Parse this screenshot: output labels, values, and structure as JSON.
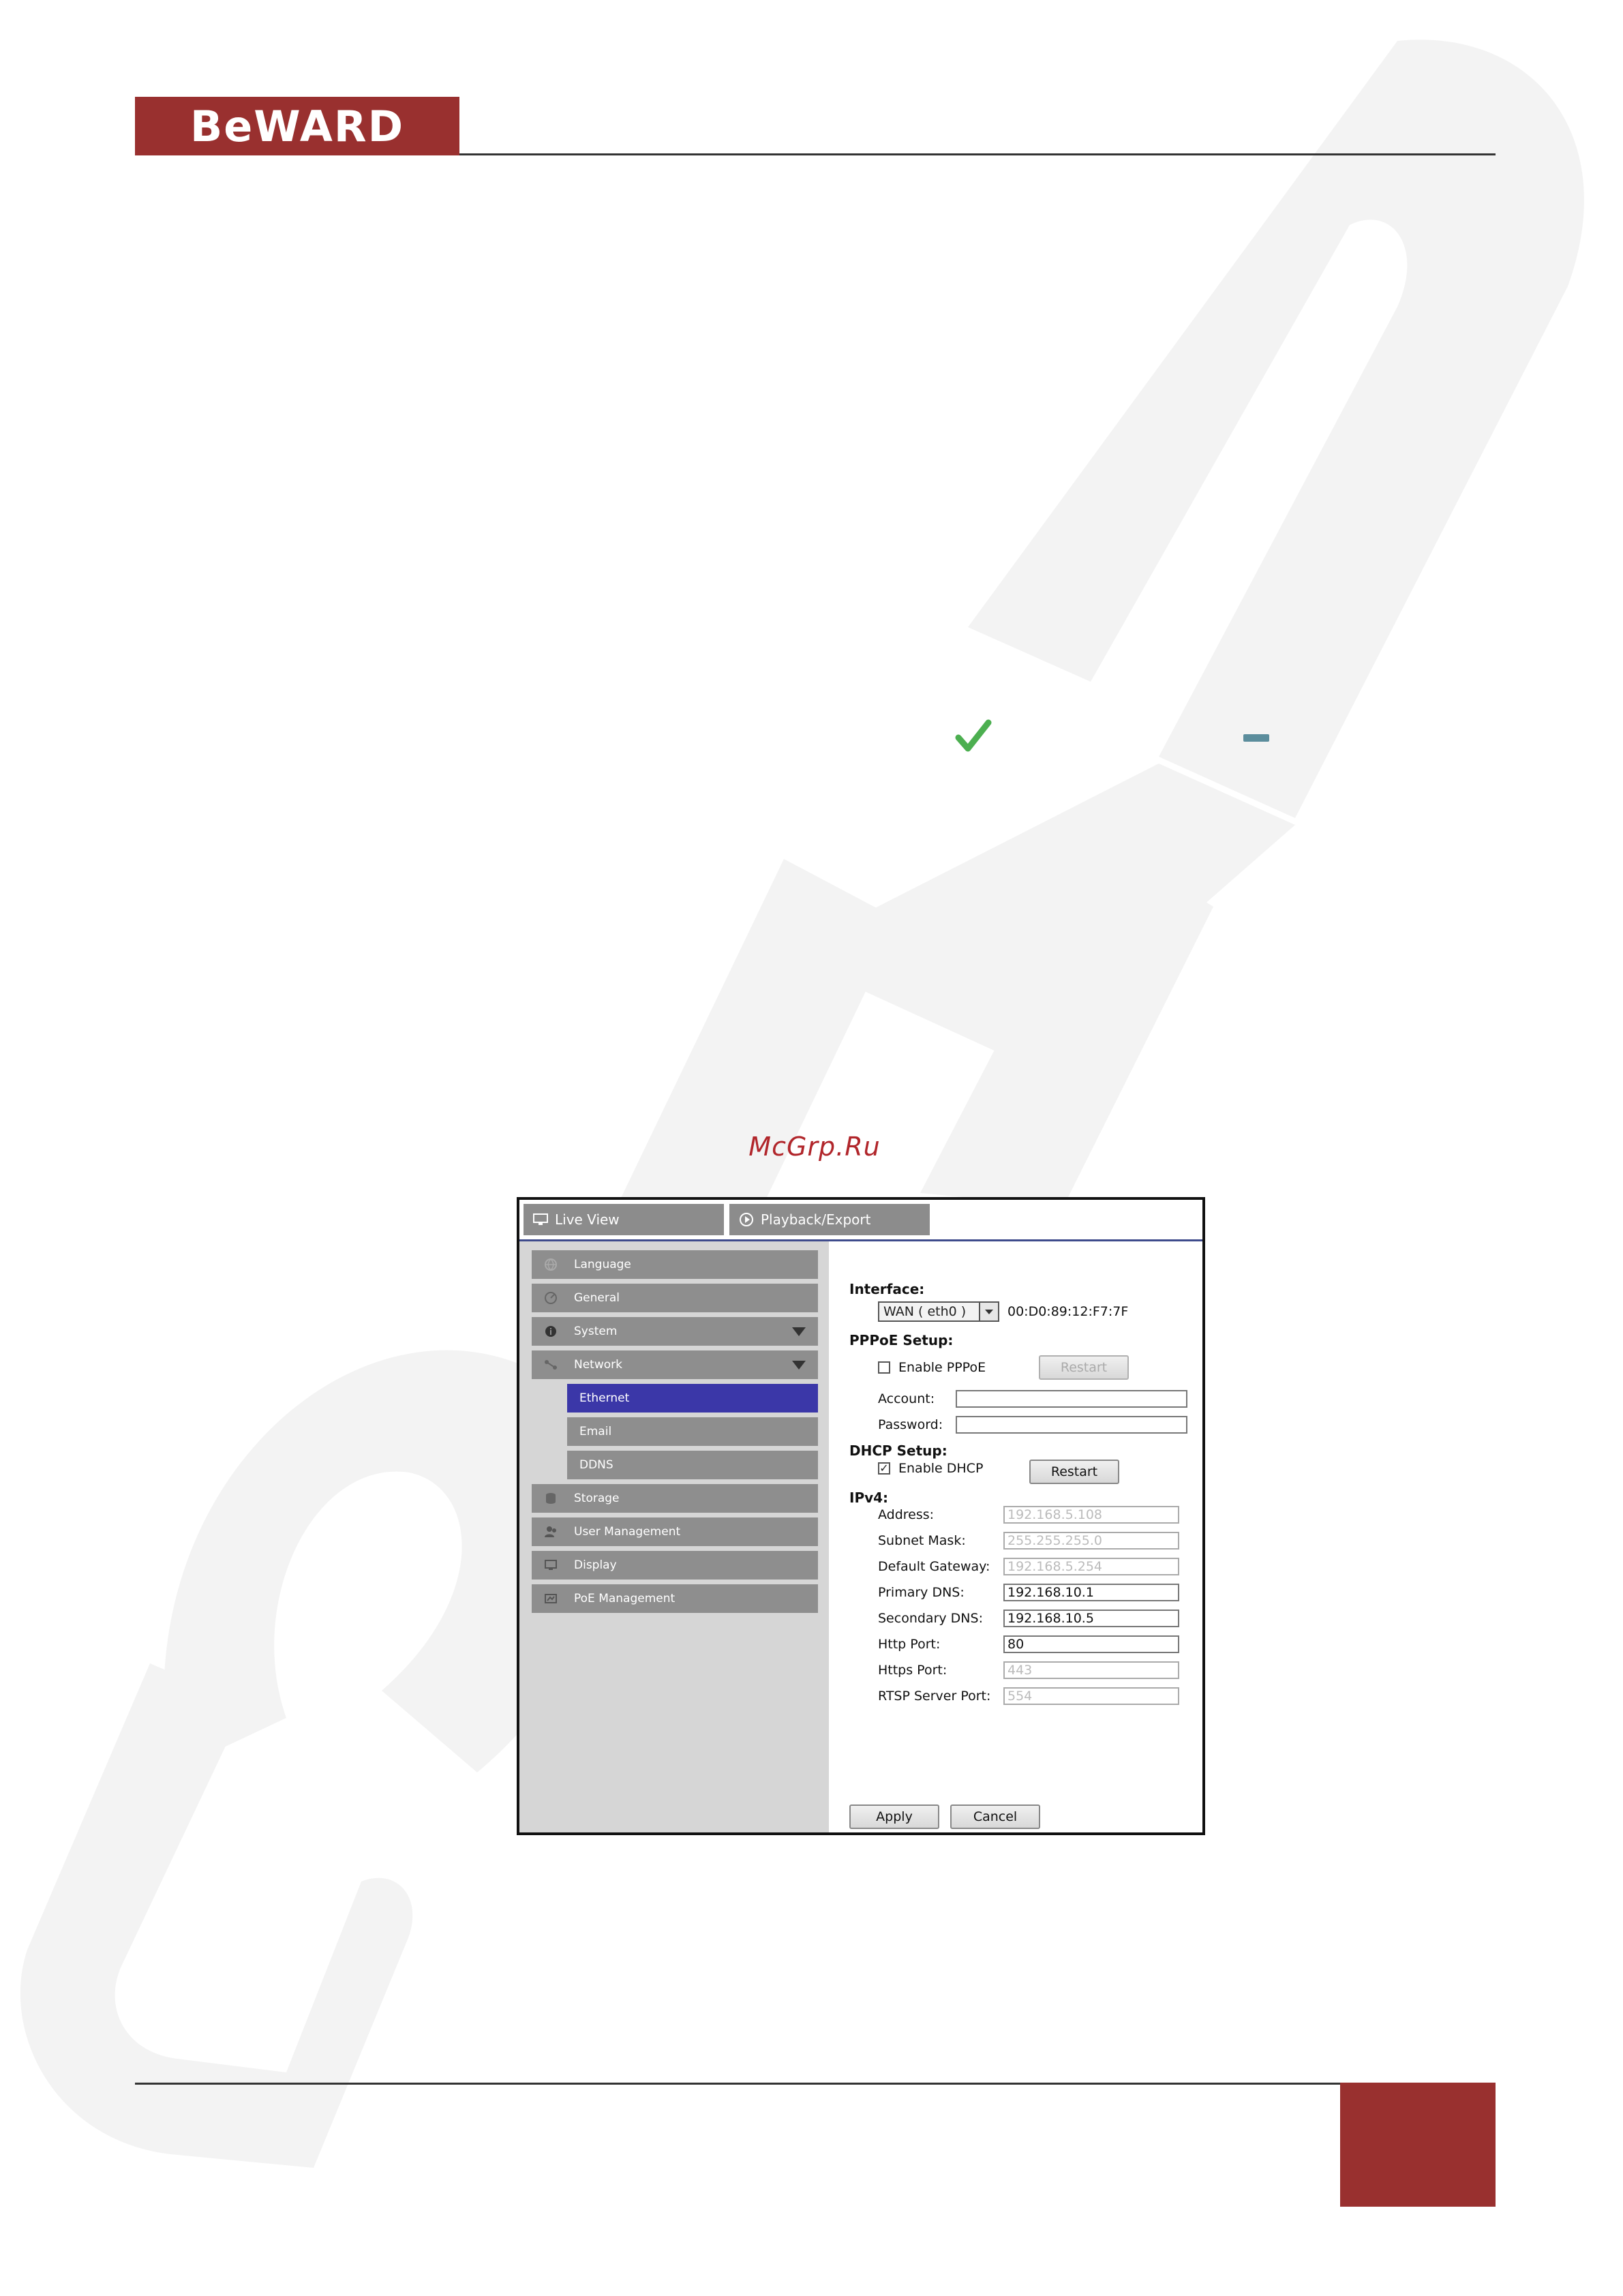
{
  "header": {
    "logo_text": "BeWARD",
    "brand_color": "#99302f"
  },
  "icons": {
    "check": "check-icon",
    "dash": "dash-icon"
  },
  "watermark_text": "McGrp.Ru",
  "ui": {
    "tabs": [
      {
        "label": "Live View",
        "icon": "monitor-icon"
      },
      {
        "label": "Playback/Export",
        "icon": "play-icon"
      }
    ],
    "sidebar": {
      "items": [
        {
          "label": "Language",
          "icon": "globe-icon"
        },
        {
          "label": "General",
          "icon": "gauge-icon"
        },
        {
          "label": "System",
          "icon": "info-icon",
          "expandable": true
        },
        {
          "label": "Network",
          "icon": "network-icon",
          "expandable": true
        },
        {
          "label": "Storage",
          "icon": "database-icon"
        },
        {
          "label": "User Management",
          "icon": "users-icon"
        },
        {
          "label": "Display",
          "icon": "monitor-icon"
        },
        {
          "label": "PoE Management",
          "icon": "poe-icon"
        }
      ],
      "network_sub": [
        {
          "label": "Ethernet",
          "active": true
        },
        {
          "label": "Email"
        },
        {
          "label": "DDNS"
        }
      ],
      "active_color": "#3b37a8"
    },
    "form": {
      "interface_heading": "Interface:",
      "interface_value": "WAN ( eth0 )",
      "mac": "00:D0:89:12:F7:7F",
      "pppoe_heading": "PPPoE Setup:",
      "enable_pppoe": "Enable PPPoE",
      "pppoe_checked": false,
      "restart_pppoe": "Restart",
      "account_label": "Account:",
      "password_label": "Password:",
      "dhcp_heading": "DHCP Setup:",
      "enable_dhcp": "Enable DHCP",
      "dhcp_checked": true,
      "restart_dhcp": "Restart",
      "ipv4_heading": "IPv4:",
      "rows": [
        {
          "label": "Address:",
          "value": "192.168.5.108",
          "disabled": true
        },
        {
          "label": "Subnet Mask:",
          "value": "255.255.255.0",
          "disabled": true
        },
        {
          "label": "Default Gateway:",
          "value": "192.168.5.254",
          "disabled": true
        },
        {
          "label": "Primary DNS:",
          "value": "192.168.10.1",
          "disabled": false
        },
        {
          "label": "Secondary DNS:",
          "value": "192.168.10.5",
          "disabled": false
        },
        {
          "label": "Http Port:",
          "value": "80",
          "disabled": false
        },
        {
          "label": "Https Port:",
          "value": "443",
          "disabled": true
        },
        {
          "label": "RTSP Server Port:",
          "value": "554",
          "disabled": true
        }
      ],
      "apply": "Apply",
      "cancel": "Cancel"
    }
  }
}
